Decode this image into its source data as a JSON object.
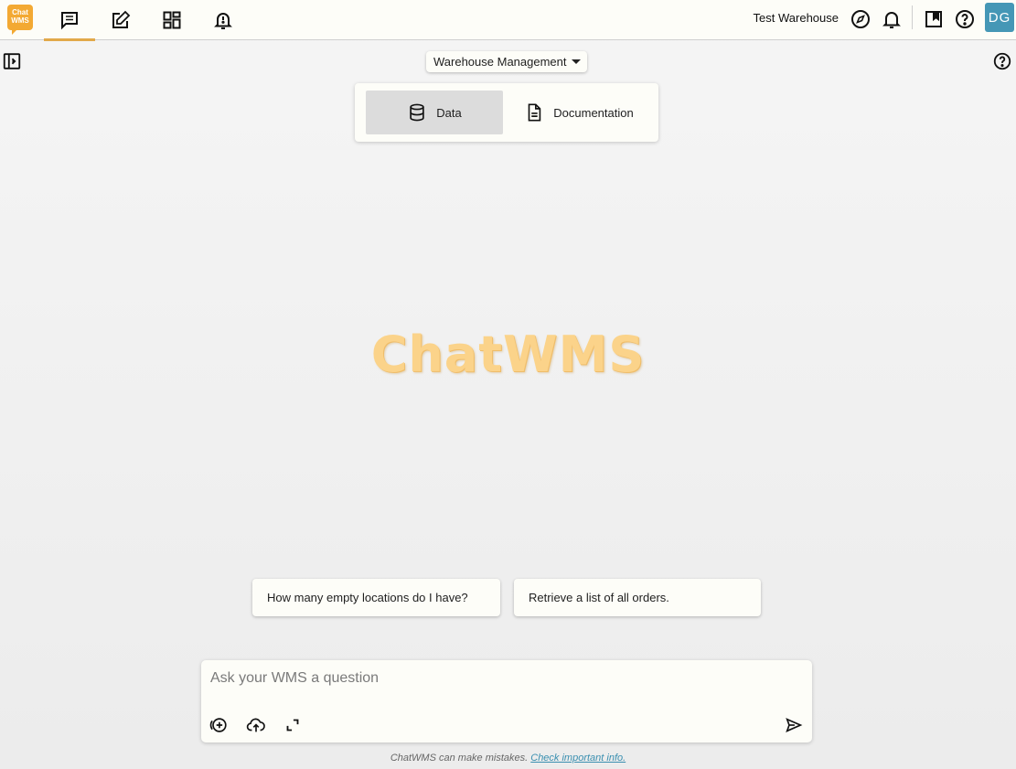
{
  "app": {
    "logo_line1": "Chat",
    "logo_line2": "WMS",
    "brand": "ChatWMS"
  },
  "topbar": {
    "nav_icons": [
      "chat-icon",
      "edit-note-icon",
      "dashboard-icon",
      "alert-bell-icon"
    ],
    "active_nav": "chat-icon",
    "warehouse": "Test Warehouse",
    "user_initials": "DG"
  },
  "mode": {
    "selected": "Warehouse Management"
  },
  "source_toggle": {
    "data_label": "Data",
    "documentation_label": "Documentation",
    "selected": "Data"
  },
  "suggestions": [
    "How many empty locations do I have?",
    "Retrieve a list of all orders."
  ],
  "ask": {
    "placeholder": "Ask your WMS a question",
    "value": ""
  },
  "disclaimer": {
    "text": "ChatWMS can make mistakes.",
    "link": "Check important info."
  },
  "colors": {
    "accent": "#e2a94a",
    "logo": "#f3a933",
    "avatar": "#4597b6",
    "brand_text": "#fbd38a"
  }
}
